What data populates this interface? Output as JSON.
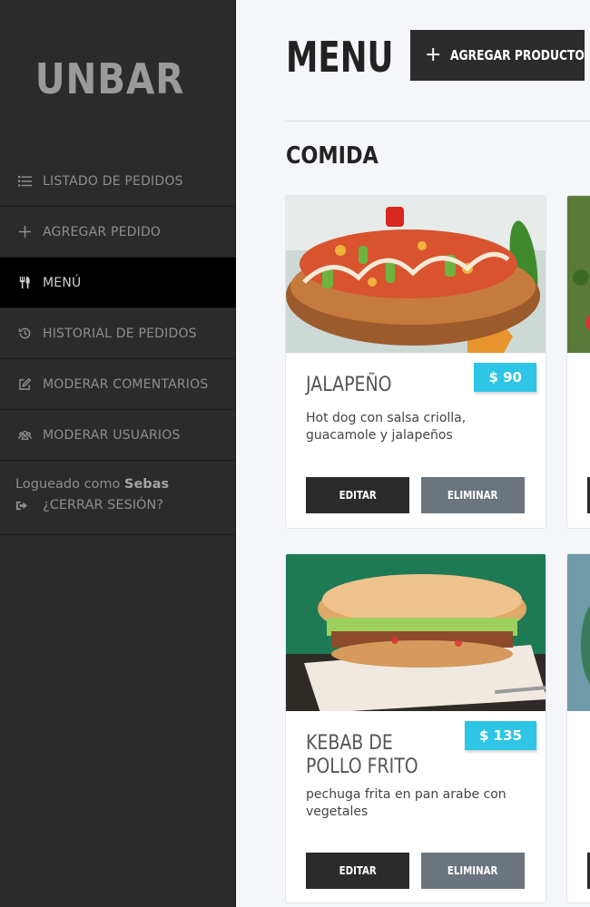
{
  "app": {
    "logo": "UNBAR"
  },
  "sidebar": {
    "items": [
      {
        "label": "LISTADO DE PEDIDOS",
        "icon": "list-icon"
      },
      {
        "label": "AGREGAR PEDIDO",
        "icon": "plus-icon"
      },
      {
        "label": "MENÚ",
        "icon": "utensils-icon",
        "active": true
      },
      {
        "label": "HISTORIAL DE PEDIDOS",
        "icon": "history-icon"
      },
      {
        "label": "MODERAR COMENTARIOS",
        "icon": "edit-icon"
      },
      {
        "label": "MODERAR USUARIOS",
        "icon": "users-icon"
      }
    ],
    "session": {
      "prefix": "Logueado como",
      "user": "Sebas",
      "logout": "¿CERRAR SESIÓN?"
    }
  },
  "main": {
    "title": "MENU",
    "add_button": {
      "icon": "+",
      "label": "AGREGAR PRODUCTO"
    },
    "section": "COMIDA",
    "products": [
      {
        "name": "JALAPEÑO",
        "price": "$ 90",
        "description": "Hot dog con salsa criolla, guacamole y jalapeños",
        "edit": "EDITAR",
        "delete": "ELIMINAR"
      },
      {
        "name": "KEBAB DE POLLO FRITO",
        "price": "$ 135",
        "description": "pechuga frita en pan arabe con vegetales",
        "edit": "EDITAR",
        "delete": "ELIMINAR"
      }
    ]
  },
  "colors": {
    "sidebar": "#2b2b2b",
    "active": "#000000",
    "accent": "#2ec5e6",
    "delete": "#6c757d"
  }
}
